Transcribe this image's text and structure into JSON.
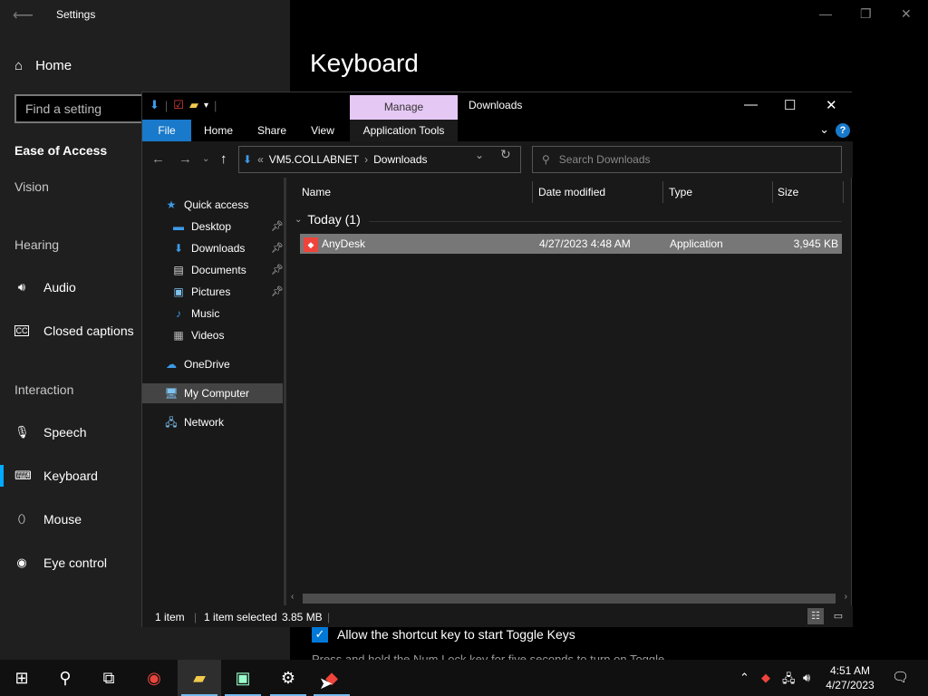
{
  "settings": {
    "title": "Settings",
    "home": "Home",
    "search_placeholder": "Find a setting",
    "section": "Ease of Access",
    "groups": {
      "vision": "Vision",
      "hearing": "Hearing",
      "interaction": "Interaction"
    },
    "items": {
      "audio": "Audio",
      "closed_captions": "Closed captions",
      "speech": "Speech",
      "keyboard": "Keyboard",
      "mouse": "Mouse",
      "eye_control": "Eye control"
    },
    "page_heading": "Keyboard",
    "toggle_keys_shortcut": "Allow the shortcut key to start Toggle Keys",
    "toggle_keys_desc": "Press and hold the Num Lock key for five seconds to turn on Toggle"
  },
  "explorer": {
    "manage_tab": "Manage",
    "title": "Downloads",
    "ribbon": {
      "file": "File",
      "home": "Home",
      "share": "Share",
      "view": "View",
      "app_tools": "Application Tools"
    },
    "address": {
      "prefix": "«",
      "root": "VM5.COLLABNET",
      "separator": "›",
      "folder": "Downloads"
    },
    "search_placeholder": "Search Downloads",
    "nav": {
      "quick_access": "Quick access",
      "desktop": "Desktop",
      "downloads": "Downloads",
      "documents": "Documents",
      "pictures": "Pictures",
      "music": "Music",
      "videos": "Videos",
      "onedrive": "OneDrive",
      "my_computer": "My Computer",
      "network": "Network"
    },
    "columns": {
      "name": "Name",
      "date": "Date modified",
      "type": "Type",
      "size": "Size"
    },
    "group": "Today (1)",
    "files": [
      {
        "name": "AnyDesk",
        "date": "4/27/2023 4:48 AM",
        "type": "Application",
        "size": "3,945 KB"
      }
    ],
    "status": {
      "count": "1 item",
      "selected": "1 item selected",
      "selected_size": "3.85 MB"
    }
  },
  "taskbar": {
    "time": "4:51 AM",
    "date": "4/27/2023"
  },
  "colors": {
    "accent": "#0078d7",
    "manage_tab": "#e6c8f5",
    "file_tab": "#1979ca",
    "anydesk": "#ef443b"
  }
}
